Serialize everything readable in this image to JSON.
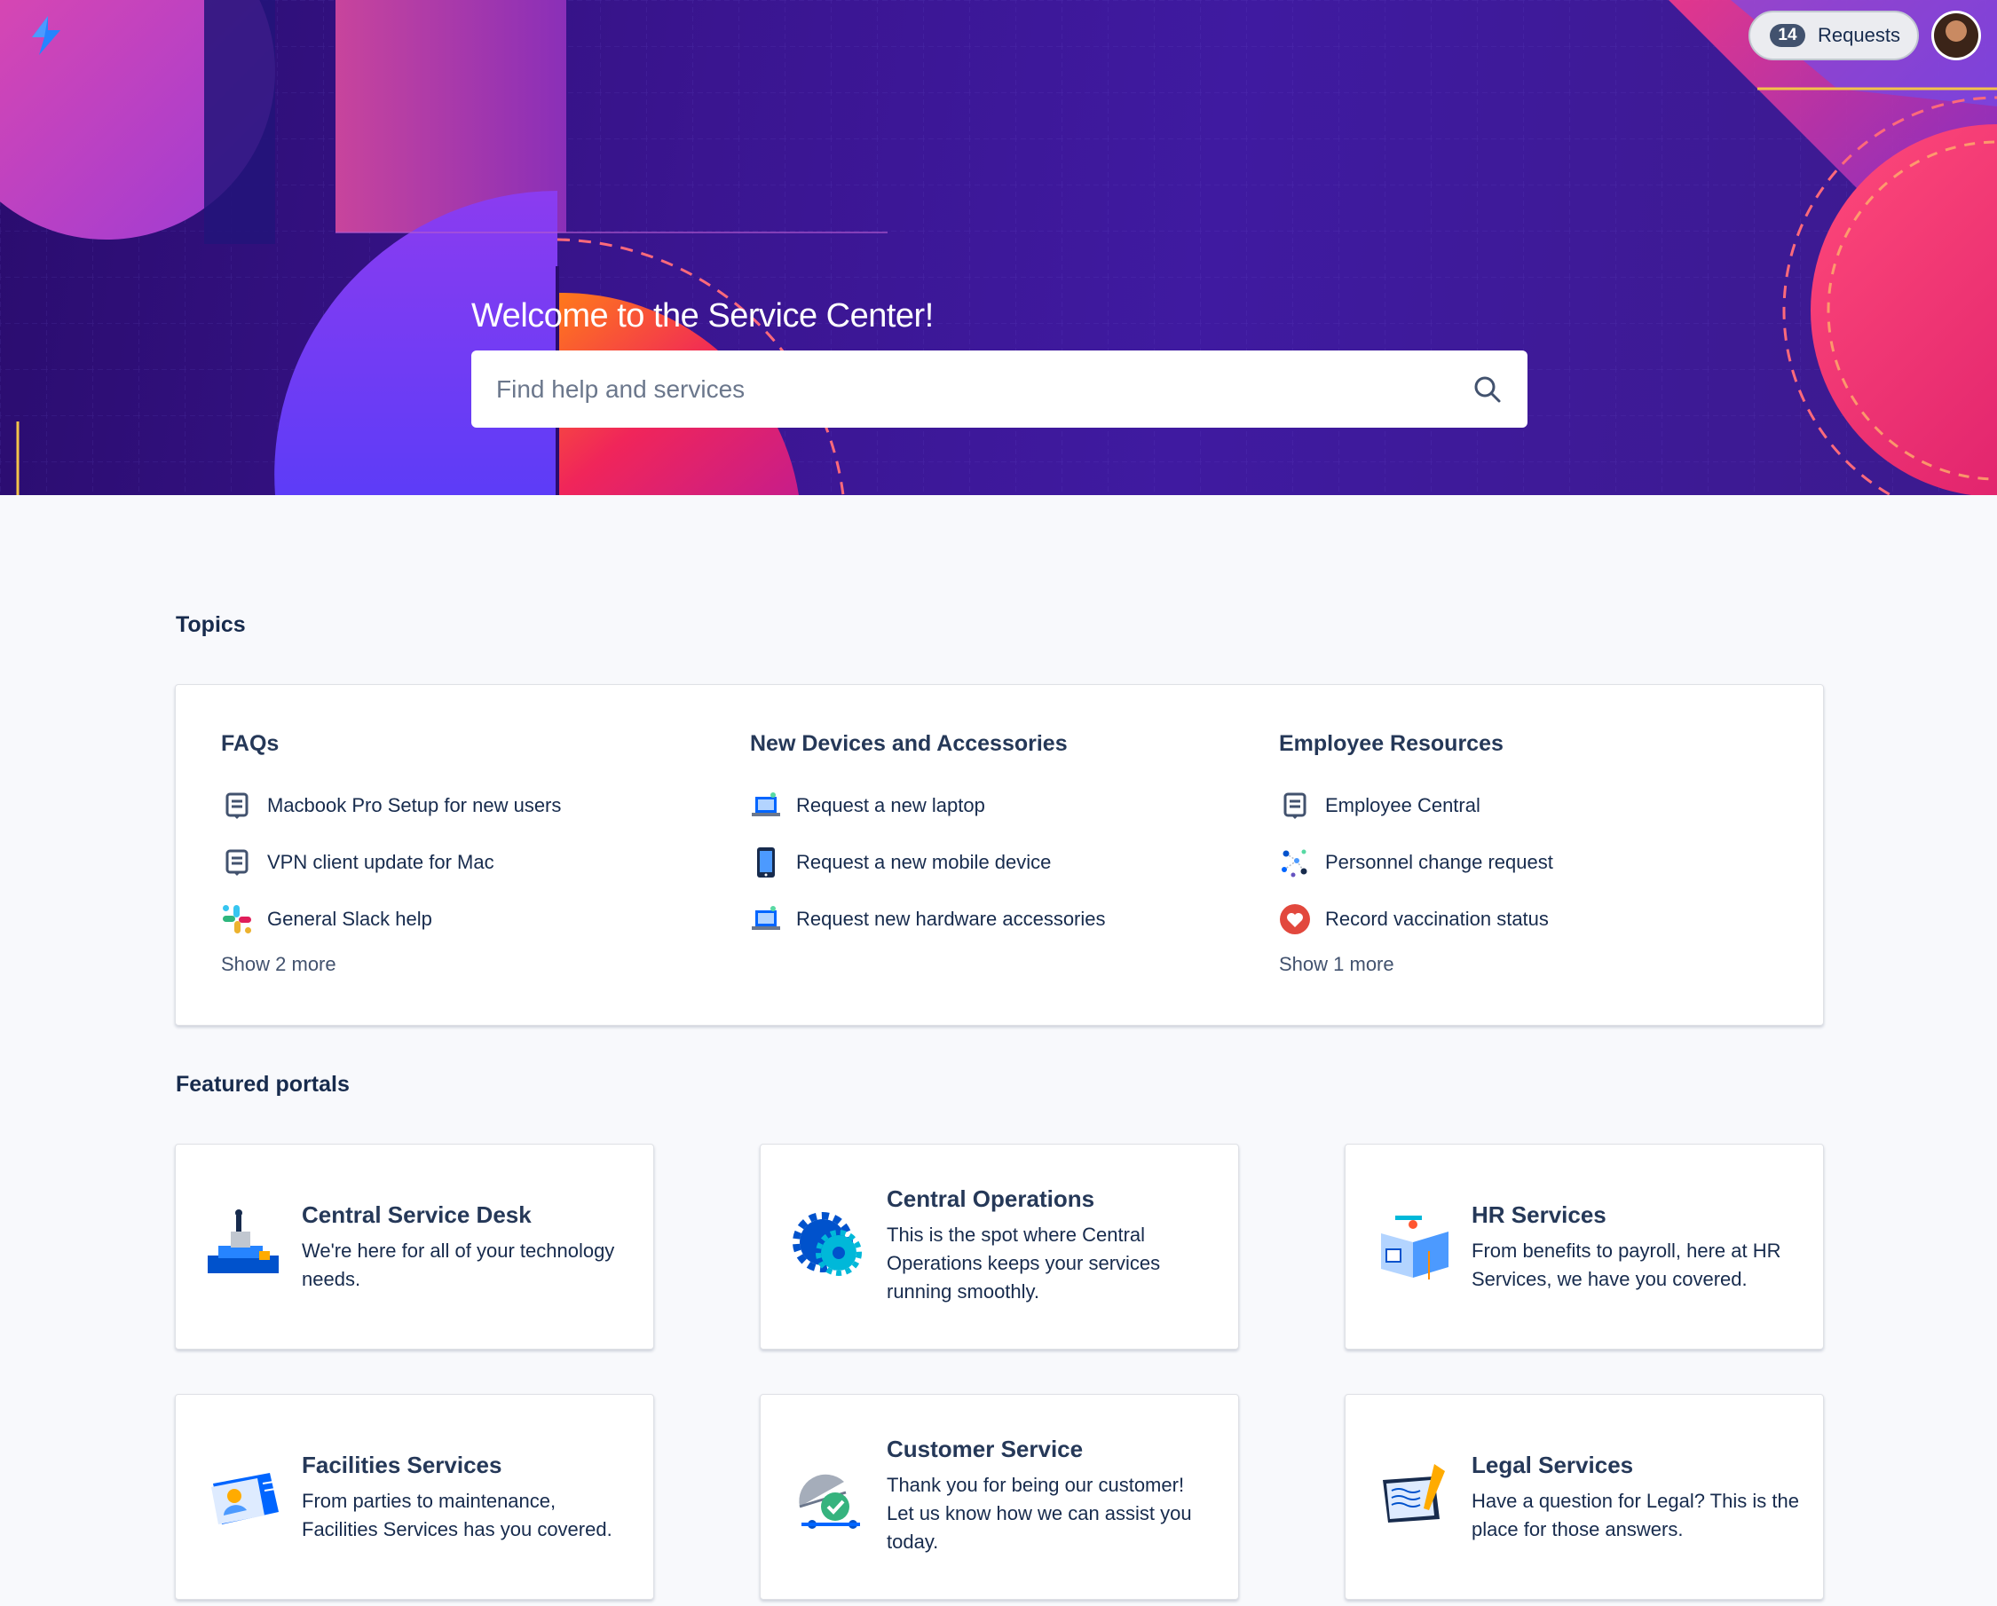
{
  "header": {
    "requests_count": "14",
    "requests_label": "Requests",
    "title": "Welcome to the Service Center!",
    "search_placeholder": "Find help and services"
  },
  "topics": {
    "title": "Topics",
    "columns": [
      {
        "heading": "FAQs",
        "items": [
          {
            "label": "Macbook Pro Setup for new users",
            "icon": "article-icon"
          },
          {
            "label": "VPN client update for Mac",
            "icon": "article-icon"
          },
          {
            "label": "General Slack help",
            "icon": "slack-icon"
          }
        ],
        "show_more": "Show 2 more"
      },
      {
        "heading": "New Devices and Accessories",
        "items": [
          {
            "label": "Request a new laptop",
            "icon": "laptop-icon"
          },
          {
            "label": "Request a new mobile device",
            "icon": "mobile-icon"
          },
          {
            "label": "Request new hardware accessories",
            "icon": "laptop-icon"
          }
        ],
        "show_more": ""
      },
      {
        "heading": "Employee Resources",
        "items": [
          {
            "label": "Employee Central",
            "icon": "article-icon"
          },
          {
            "label": "Personnel change request",
            "icon": "network-icon"
          },
          {
            "label": "Record vaccination status",
            "icon": "heart-icon"
          }
        ],
        "show_more": "Show 1 more"
      }
    ]
  },
  "portals": {
    "title": "Featured portals",
    "items": [
      {
        "title": "Central Service Desk",
        "description": "We're here for all of your technology needs.",
        "icon": "service-desk-illustration"
      },
      {
        "title": "Central Operations",
        "description": "This is the spot where Central Operations keeps your services running smoothly.",
        "icon": "gears-illustration"
      },
      {
        "title": "HR Services",
        "description": "From benefits to payroll, here at HR Services, we have you covered.",
        "icon": "hr-illustration"
      },
      {
        "title": "Facilities Services",
        "description": "From parties to maintenance, Facilities Services has you covered.",
        "icon": "id-card-illustration"
      },
      {
        "title": "Customer Service",
        "description": "Thank you for being our customer! Let us know how we can assist you today.",
        "icon": "cloche-illustration"
      },
      {
        "title": "Legal Services",
        "description": "Have a question for Legal? This is the place for those answers.",
        "icon": "legal-illustration"
      }
    ]
  },
  "colors": {
    "hero_bg": "#3a1590",
    "accent_blue": "#0052cc",
    "text_dark": "#172b4d"
  }
}
